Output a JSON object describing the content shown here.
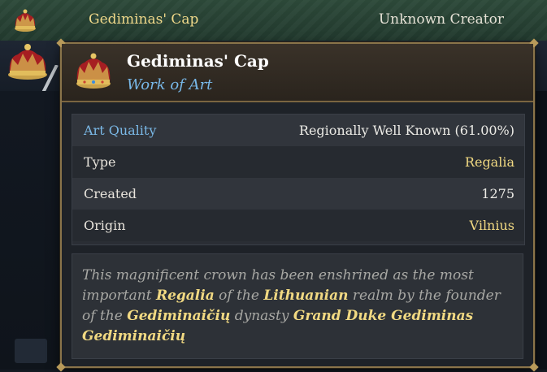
{
  "list_row": {
    "name": "Gediminas' Cap",
    "creator": "Unknown Creator"
  },
  "tooltip": {
    "title": "Gediminas' Cap",
    "subtitle": "Work of Art",
    "stats": [
      {
        "label": "Art Quality",
        "value": "Regionally Well Known (61.00%)"
      },
      {
        "label": "Type",
        "value": "Regalia"
      },
      {
        "label": "Created",
        "value": "1275"
      },
      {
        "label": "Origin",
        "value": "Vilnius"
      }
    ],
    "description": {
      "p1": "This magnificent crown has been enshrined as the most important ",
      "h1": "Regalia",
      "p2": " of the ",
      "h2": "Lithuanian",
      "p3": " realm by the founder of the ",
      "h3": "Gediminaičių",
      "p4": " dynasty ",
      "h4": "Grand Duke Gediminas Gediminaičių"
    }
  },
  "colors": {
    "gold_text": "#f1d982",
    "blue_text": "#7ab8e6",
    "frame_gold": "#8a744a"
  },
  "icons": [
    "crown-icon"
  ]
}
